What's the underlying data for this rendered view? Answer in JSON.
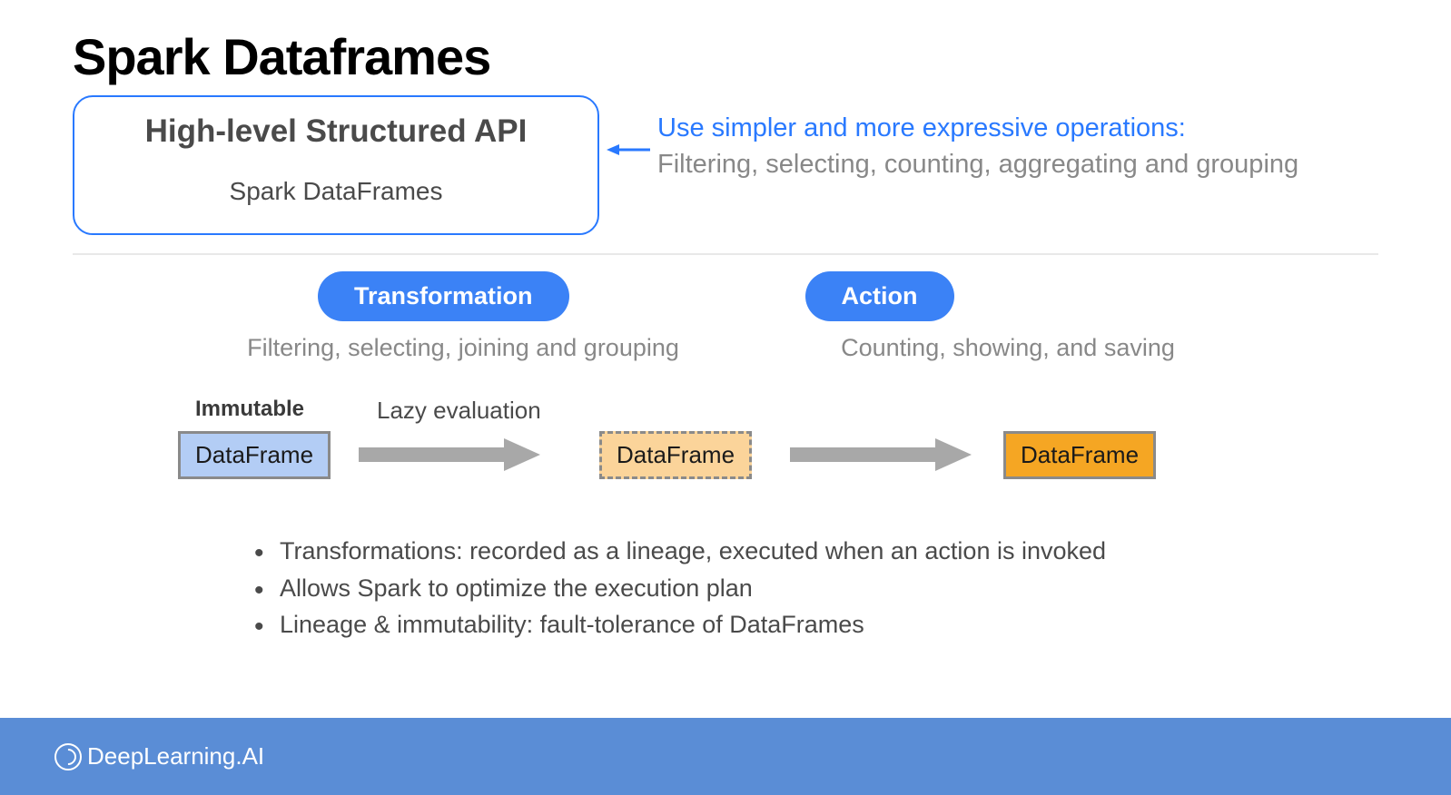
{
  "title": "Spark Dataframes",
  "apiBox": {
    "title": "High-level Structured API",
    "subtitle": "Spark DataFrames"
  },
  "sideText": {
    "blue": "Use simpler and more expressive operations:",
    "gray": "Filtering, selecting, counting, aggregating and grouping"
  },
  "pills": {
    "transformation": "Transformation",
    "action": "Action"
  },
  "captions": {
    "transformation": "Filtering, selecting, joining and grouping",
    "action": "Counting, showing, and saving"
  },
  "flow": {
    "immutable": "Immutable",
    "lazy": "Lazy evaluation",
    "df1": "DataFrame",
    "df2": "DataFrame",
    "df3": "DataFrame"
  },
  "bullets": [
    "Transformations: recorded as a lineage, executed when an action is invoked",
    "Allows Spark to optimize the execution plan",
    "Lineage & immutability: fault-tolerance of DataFrames"
  ],
  "footer": {
    "brand": "DeepLearning.AI"
  }
}
